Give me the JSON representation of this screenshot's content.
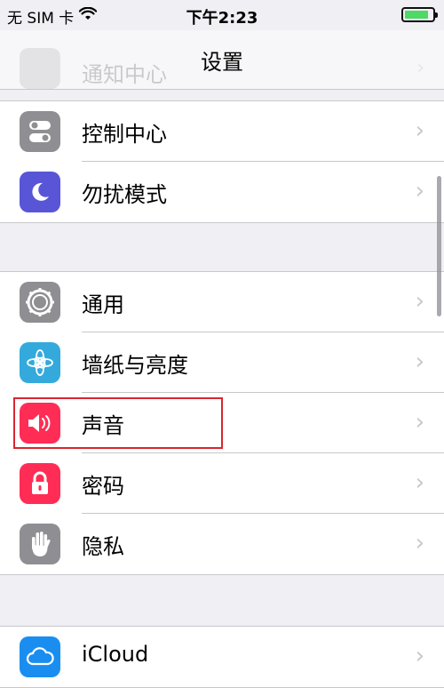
{
  "status_bar": {
    "carrier": "无 SIM 卡",
    "wifi_icon": "wifi-icon",
    "time": "下午2:23",
    "battery_level": 0.85,
    "battery_color": "#4cd964"
  },
  "nav": {
    "title": "设置",
    "ghost_label": "通知中心"
  },
  "groups": [
    {
      "items": [
        {
          "label": "控制中心",
          "icon": "control-center-icon",
          "color": "#8e8e93"
        },
        {
          "label": "勿扰模式",
          "icon": "moon-icon",
          "color": "#5856d6"
        }
      ]
    },
    {
      "items": [
        {
          "label": "通用",
          "icon": "gear-icon",
          "color": "#8e8e93"
        },
        {
          "label": "墙纸与亮度",
          "icon": "flower-icon",
          "color": "#34aadc"
        },
        {
          "label": "声音",
          "icon": "speaker-icon",
          "color": "#ff2d55"
        },
        {
          "label": "密码",
          "icon": "lock-icon",
          "color": "#ff2d55"
        },
        {
          "label": "隐私",
          "icon": "hand-icon",
          "color": "#8e8e93"
        }
      ]
    },
    {
      "items": [
        {
          "label": "iCloud",
          "icon": "cloud-icon",
          "color": "#1a8ef0"
        }
      ]
    }
  ],
  "chevron": "›"
}
